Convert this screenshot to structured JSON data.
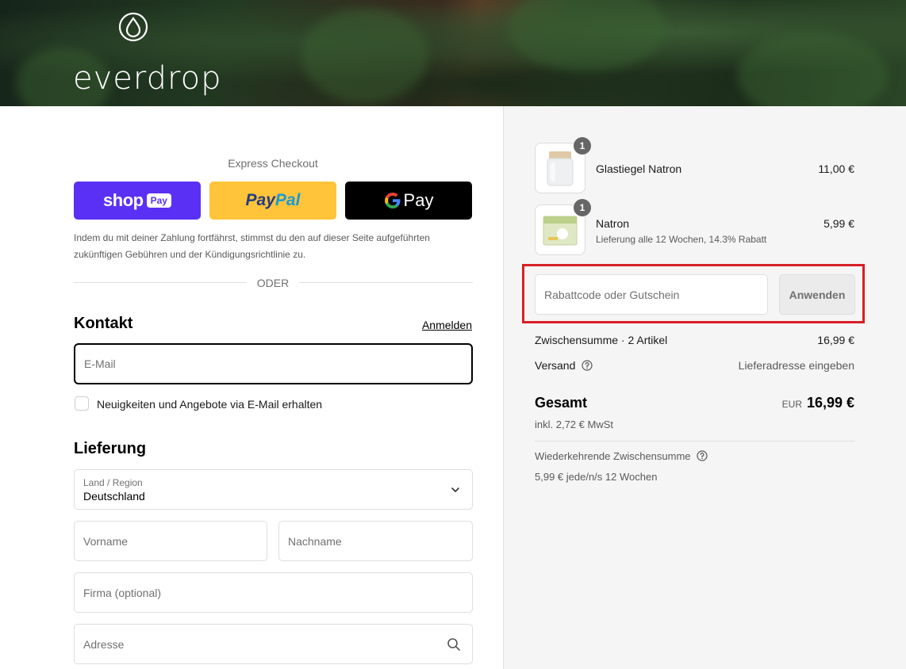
{
  "brand": {
    "name": "everdrop"
  },
  "express": {
    "title": "Express Checkout",
    "shop_word": "shop",
    "shop_badge": "Pay",
    "paypal_a": "Pay",
    "paypal_b": "Pal",
    "gpay_g": "G",
    "gpay_word": "Pay",
    "legal": "Indem du mit deiner Zahlung fortfährst, stimmst du den auf dieser Seite aufgeführten zukünftigen Gebühren und der Kündigungsrichtlinie zu.",
    "or": "ODER"
  },
  "contact": {
    "title": "Kontakt",
    "login": "Anmelden",
    "email_placeholder": "E-Mail",
    "newsletter": "Neuigkeiten und Angebote via E-Mail erhalten"
  },
  "delivery": {
    "title": "Lieferung",
    "country_label": "Land / Region",
    "country_value": "Deutschland",
    "firstname_placeholder": "Vorname",
    "lastname_placeholder": "Nachname",
    "company_placeholder": "Firma (optional)",
    "address_placeholder": "Adresse"
  },
  "summary": {
    "items": [
      {
        "qty": "1",
        "name": "Glastiegel Natron",
        "subtitle": "",
        "price": "11,00 €"
      },
      {
        "qty": "1",
        "name": "Natron",
        "subtitle": "Lieferung alle 12 Wochen, 14.3% Rabatt",
        "price": "5,99 €"
      }
    ],
    "discount_placeholder": "Rabattcode oder Gutschein",
    "apply_label": "Anwenden",
    "subtotal_label": "Zwischensumme · 2 Artikel",
    "subtotal_value": "16,99 €",
    "shipping_label": "Versand",
    "shipping_value": "Lieferadresse eingeben",
    "total_label": "Gesamt",
    "total_currency": "EUR",
    "total_value": "16,99 €",
    "tax_note": "inkl. 2,72 € MwSt",
    "recurring_label": "Wiederkehrende Zwischensumme",
    "recurring_value": "5,99 € jede/n/s 12 Wochen"
  },
  "colors": {
    "shop": "#5a31f4",
    "paypal": "#ffc439",
    "gpay": "#000000",
    "highlight": "#d81f26"
  }
}
